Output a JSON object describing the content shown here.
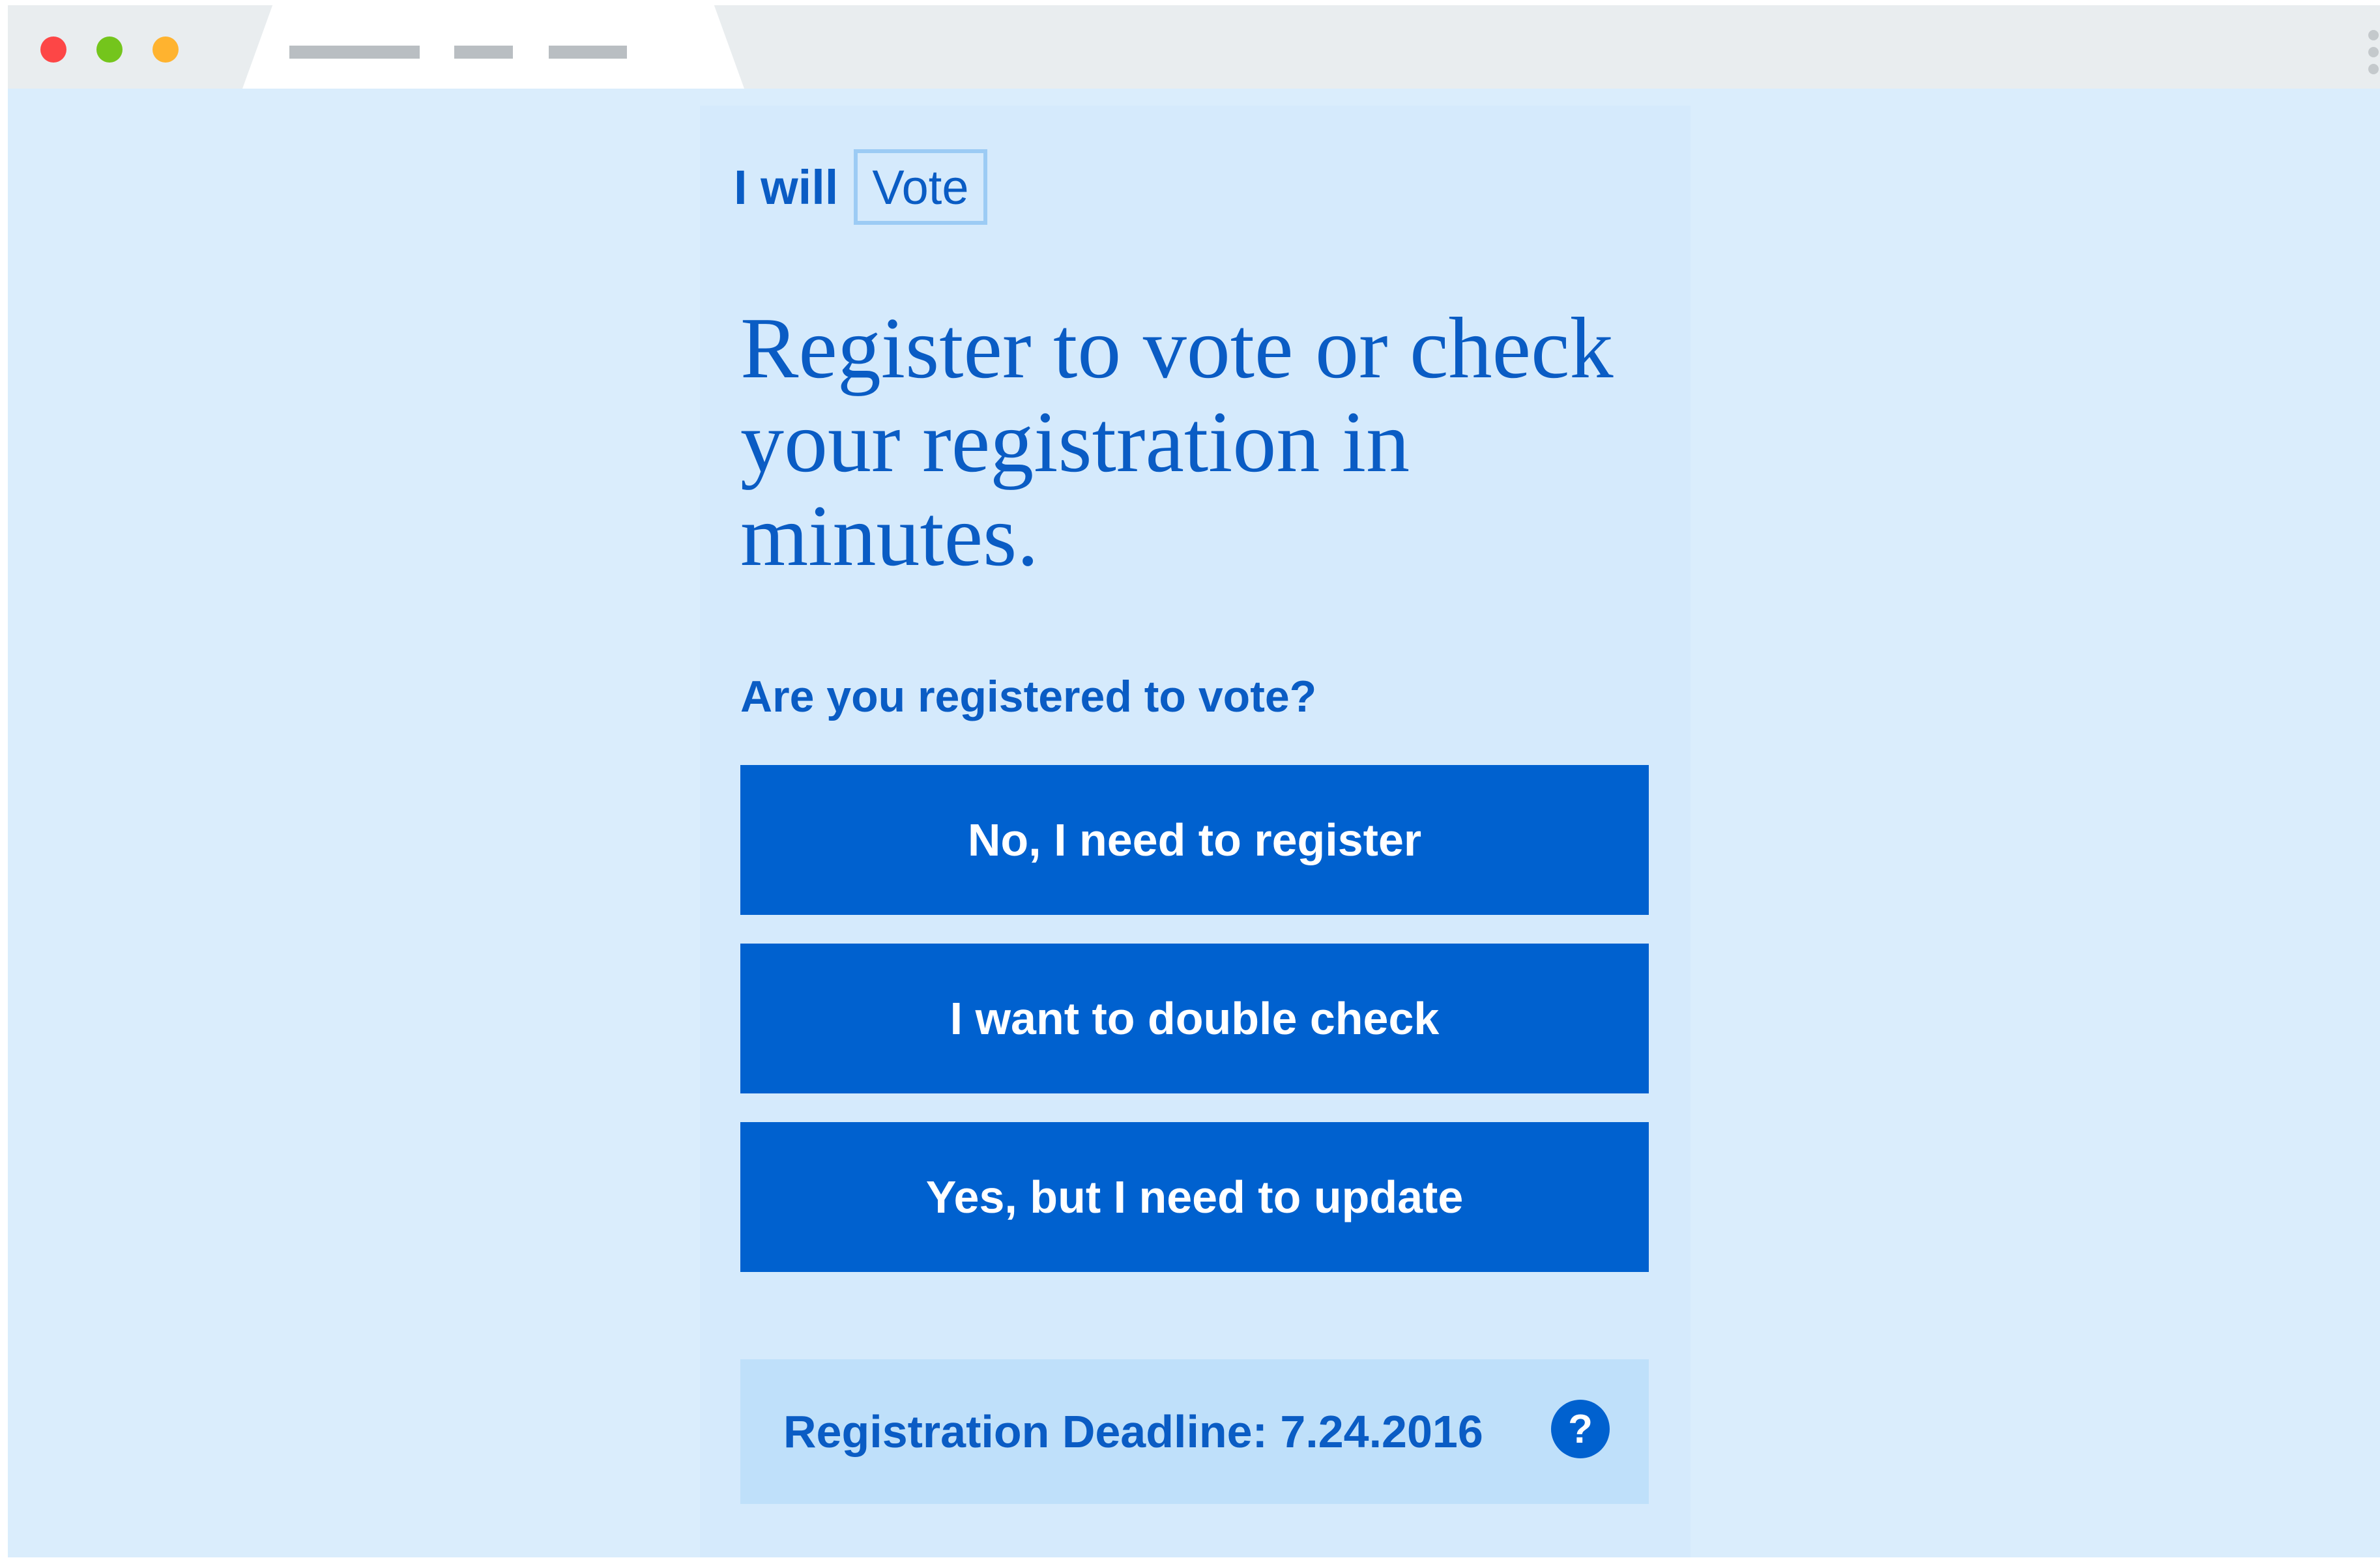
{
  "browser": {
    "tab_placeholders": 3,
    "traffic_light_colors": [
      "#fd4646",
      "#74c51c",
      "#ffb32f"
    ]
  },
  "logo": {
    "prefix": "I will",
    "boxed_word": "Vote"
  },
  "headline": "Register to vote or check your registration in minutes.",
  "question": "Are you registered to vote?",
  "options": [
    {
      "label": "No, I need to register"
    },
    {
      "label": "I want to double check"
    },
    {
      "label": "Yes, but I need to update"
    }
  ],
  "deadline": {
    "text": "Registration Deadline: 7.24.2016",
    "help_glyph": "?"
  },
  "colors": {
    "brand_blue": "#0061cf",
    "text_blue": "#0a5cc4",
    "page_bg": "#daedfc",
    "deadline_bg": "#bfe0fa"
  }
}
